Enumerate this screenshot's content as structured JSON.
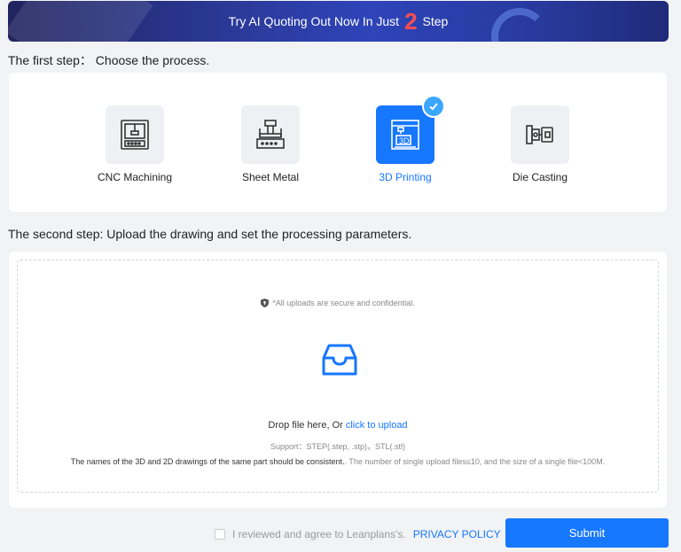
{
  "banner": {
    "text_before": "Try AI Quoting Out Now In Just",
    "number": "2",
    "text_after": "Step"
  },
  "step1": {
    "title": "The first step： Choose the process."
  },
  "processes": [
    {
      "label": "CNC Machining",
      "icon": "cnc-machine-icon",
      "selected": false
    },
    {
      "label": "Sheet Metal",
      "icon": "sheet-metal-icon",
      "selected": false
    },
    {
      "label": "3D Printing",
      "icon": "3d-printer-icon",
      "selected": true
    },
    {
      "label": "Die Casting",
      "icon": "die-casting-icon",
      "selected": false
    }
  ],
  "step2": {
    "title": "The second step: Upload the drawing and set the processing parameters."
  },
  "upload": {
    "secure_text": "*All uploads are secure and confidential.",
    "drop_text": "Drop file here, Or ",
    "click_text": "click to upload",
    "support_text": "Support：STEP(.step, .stp)，STL(.stl)",
    "note_dark": "The names of the 3D and 2D drawings of the same part should be consistent.",
    "note_light": ".  The number of single upload files≤10, and the size of a single file<100M."
  },
  "footer": {
    "agree_text": "I reviewed and agree to Leanplans's.",
    "policy_link": "PRIVACY POLICY",
    "submit_label": "Submit"
  },
  "colors": {
    "primary": "#1677ff",
    "banner_dark": "#20245e",
    "highlight_number": "#ff4d4f"
  }
}
